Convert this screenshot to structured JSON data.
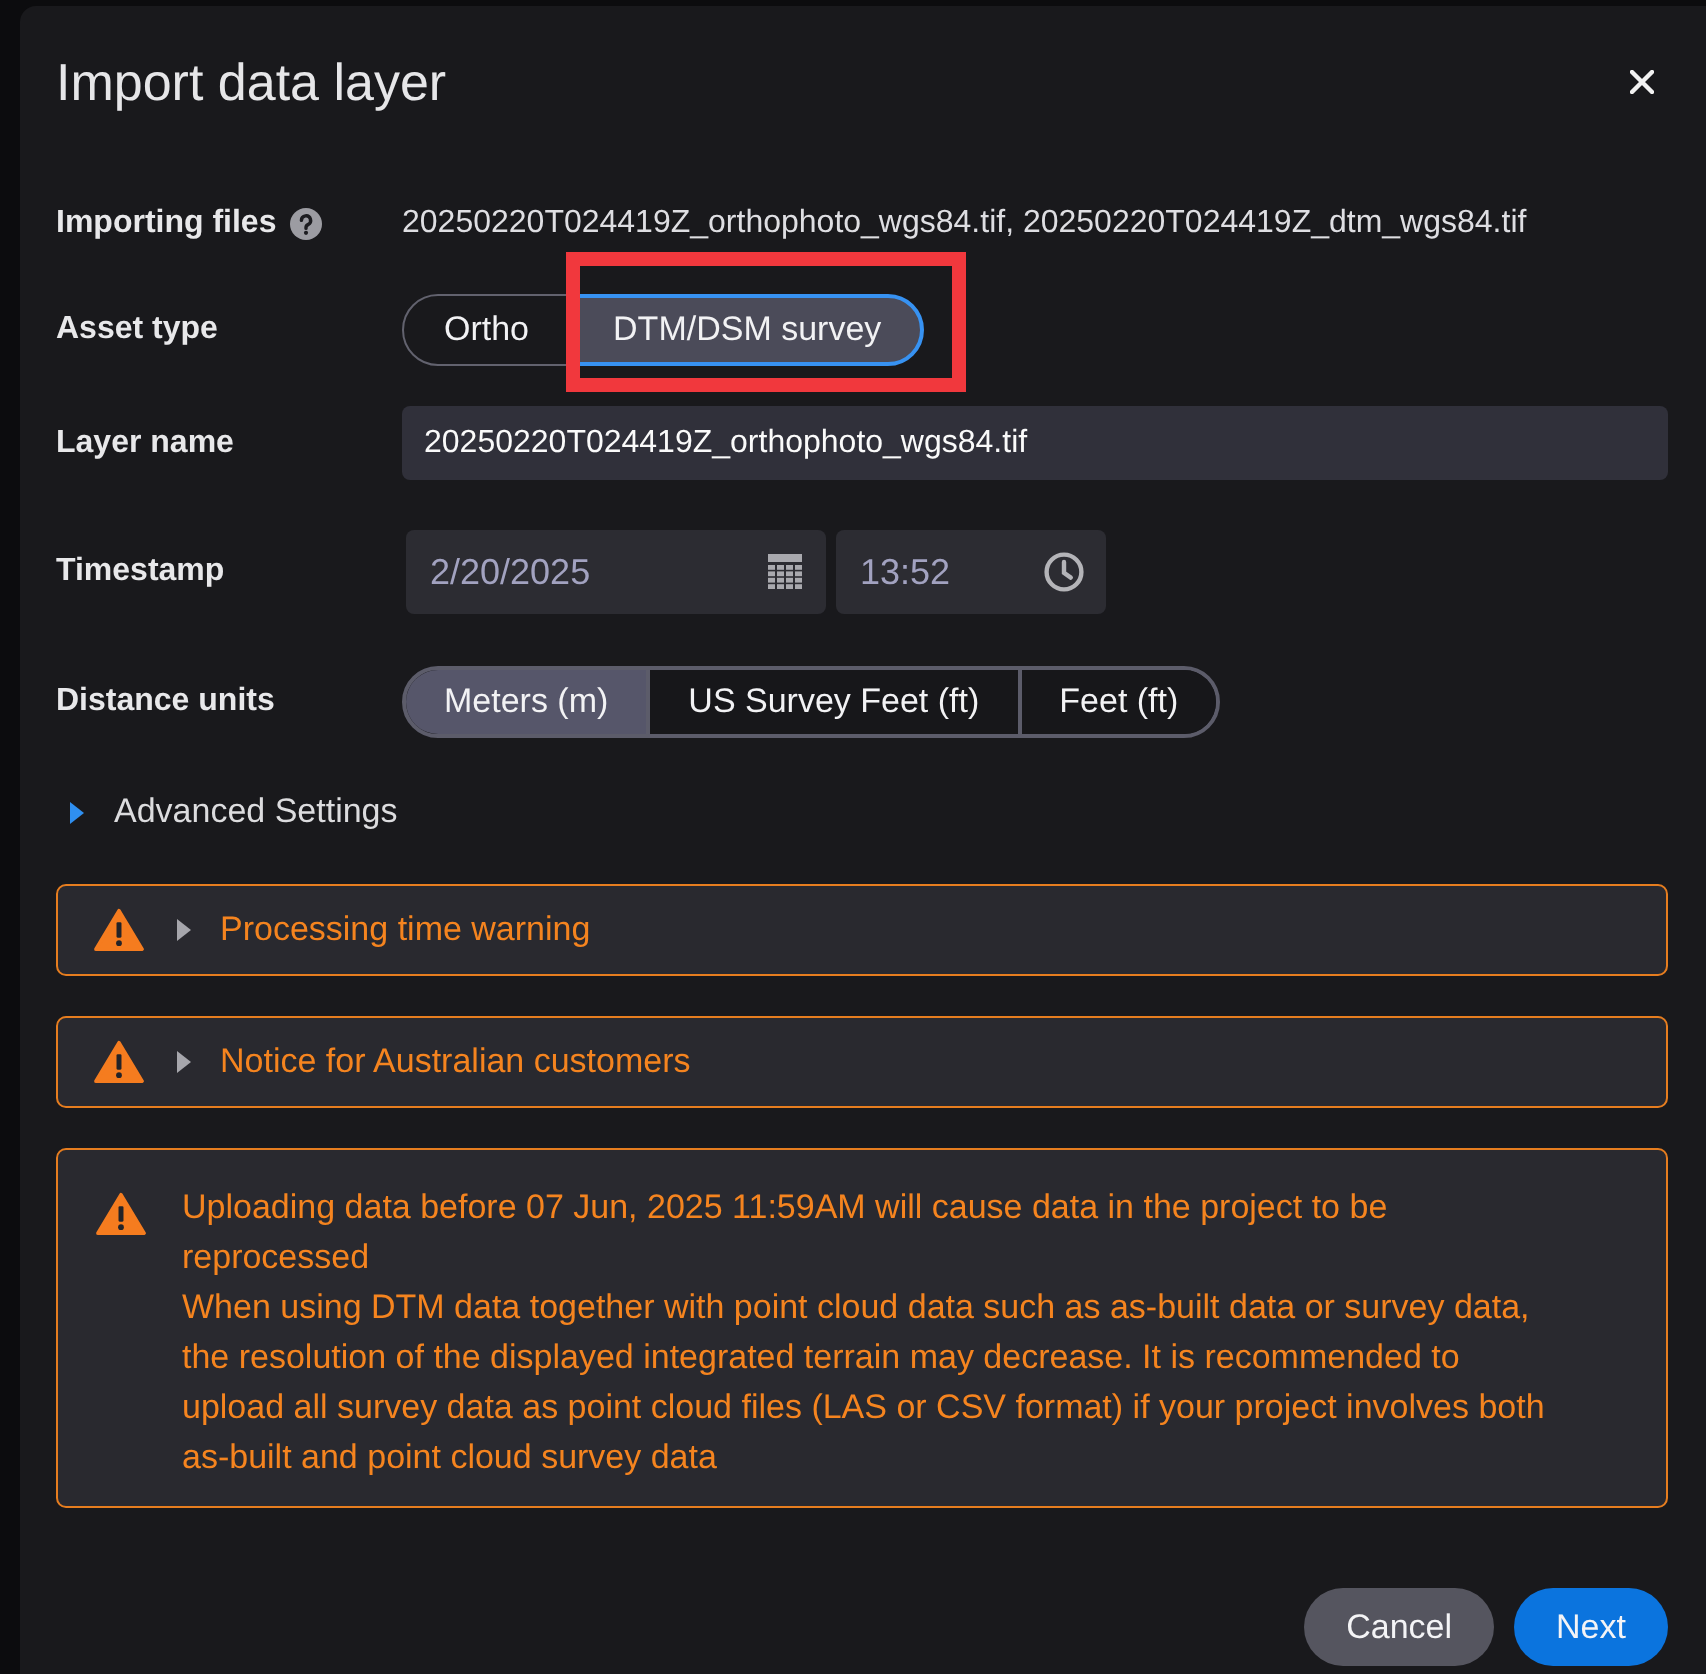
{
  "dialog": {
    "title": "Import data layer"
  },
  "importing_files": {
    "label": "Importing files",
    "value": "20250220T024419Z_orthophoto_wgs84.tif, 20250220T024419Z_dtm_wgs84.tif"
  },
  "asset_type": {
    "label": "Asset type",
    "options": [
      {
        "label": "Ortho",
        "selected": false,
        "highlighted": false
      },
      {
        "label": "DTM/DSM survey",
        "selected": true,
        "highlighted": true
      }
    ]
  },
  "layer_name": {
    "label": "Layer name",
    "value": "20250220T024419Z_orthophoto_wgs84.tif"
  },
  "timestamp": {
    "label": "Timestamp",
    "date": "2/20/2025",
    "time": "13:52",
    "disabled": true
  },
  "distance_units": {
    "label": "Distance units",
    "options": [
      {
        "label": "Meters (m)",
        "selected": true
      },
      {
        "label": "US Survey Feet (ft)",
        "selected": false
      },
      {
        "label": "Feet (ft)",
        "selected": false
      }
    ]
  },
  "advanced_settings": {
    "label": "Advanced Settings",
    "expanded": false
  },
  "notices": [
    {
      "kind": "collapsible",
      "title": "Processing time warning",
      "expanded": false
    },
    {
      "kind": "collapsible",
      "title": "Notice for Australian customers",
      "expanded": false
    },
    {
      "kind": "message",
      "paragraphs": [
        "Uploading data before 07 Jun, 2025 11:59AM will cause data in the project to be reprocessed",
        "When using DTM data together with point cloud data such as as-built data or survey data, the resolution of the displayed integrated terrain may decrease. It is recommended to upload all survey data as point cloud files (LAS or CSV format) if your project involves both as-built and point cloud survey data"
      ]
    }
  ],
  "buttons": [
    {
      "label": "Cancel",
      "kind": "secondary"
    },
    {
      "label": "Next",
      "kind": "primary"
    }
  ]
}
